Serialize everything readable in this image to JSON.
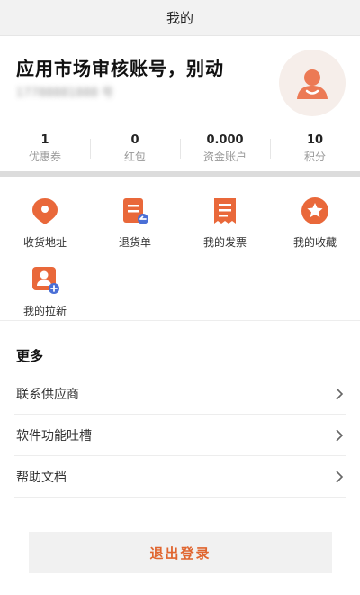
{
  "header": {
    "title": "我的"
  },
  "profile": {
    "name": "应用市场审核账号，别动",
    "phone": "17788881888 号"
  },
  "stats": [
    {
      "value": "1",
      "label": "优惠券"
    },
    {
      "value": "0",
      "label": "红包"
    },
    {
      "value": "0.000",
      "label": "资金账户"
    },
    {
      "value": "10",
      "label": "积分"
    }
  ],
  "quick_actions": [
    {
      "label": "收货地址",
      "icon": "location-pin-icon"
    },
    {
      "label": "退货单",
      "icon": "return-order-icon"
    },
    {
      "label": "我的发票",
      "icon": "invoice-icon"
    },
    {
      "label": "我的收藏",
      "icon": "star-favorite-icon"
    },
    {
      "label": "我的拉新",
      "icon": "invite-user-icon"
    }
  ],
  "more": {
    "title": "更多",
    "items": [
      {
        "label": "联系供应商"
      },
      {
        "label": "软件功能吐槽"
      },
      {
        "label": "帮助文档"
      }
    ]
  },
  "logout": {
    "label": "退出登录"
  },
  "colors": {
    "accent": "#e9683a",
    "avatar_bg": "#f6eeea",
    "divider": "#dcdcdc"
  }
}
